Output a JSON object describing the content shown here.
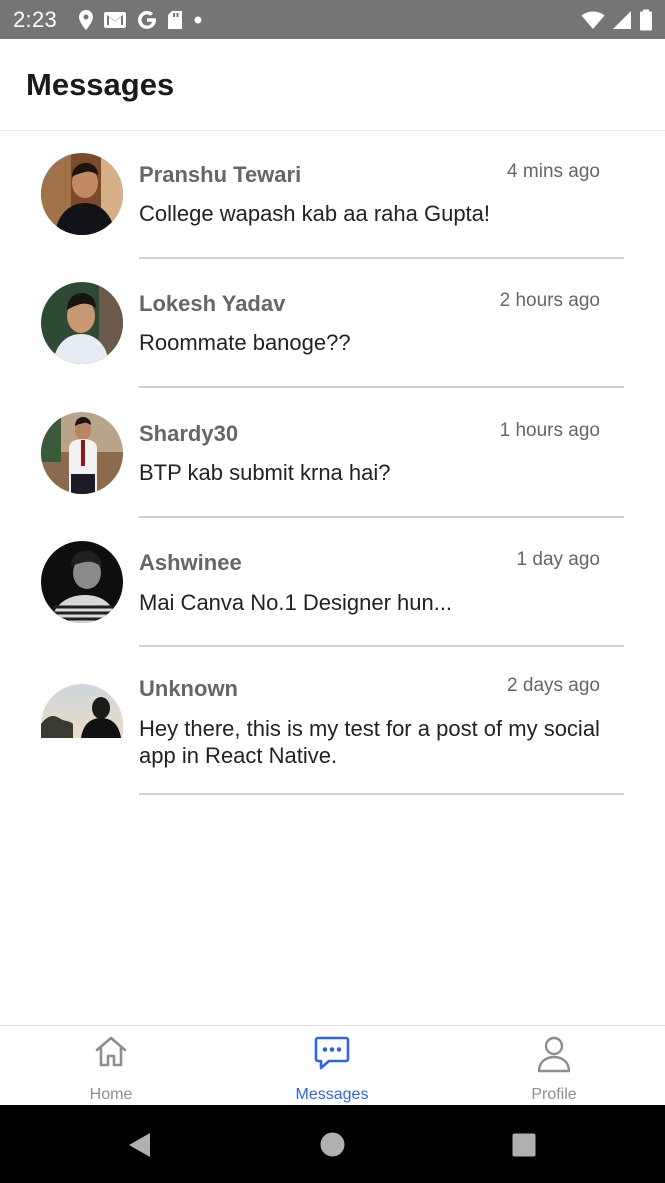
{
  "status_bar": {
    "time": "2:23"
  },
  "header": {
    "title": "Messages"
  },
  "messages": [
    {
      "name": "Pranshu Tewari",
      "time": "4 mins ago",
      "text": "College wapash kab aa raha Gupta!"
    },
    {
      "name": "Lokesh Yadav",
      "time": "2 hours ago",
      "text": "Roommate banoge??"
    },
    {
      "name": "Shardy30",
      "time": "1 hours ago",
      "text": "BTP kab submit krna hai?"
    },
    {
      "name": "Ashwinee",
      "time": "1 day ago",
      "text": "Mai Canva No.1 Designer hun..."
    },
    {
      "name": "Unknown",
      "time": "2 days ago",
      "text": "Hey there, this is my test for a post of my social app in React Native."
    }
  ],
  "tabs": [
    {
      "label": "Home",
      "icon": "home-icon"
    },
    {
      "label": "Messages",
      "icon": "chat-icon",
      "active": true
    },
    {
      "label": "Profile",
      "icon": "person-icon"
    }
  ],
  "colors": {
    "accent": "#2e64e5",
    "inactive": "#8e8e8e",
    "status_bar": "#757575"
  }
}
